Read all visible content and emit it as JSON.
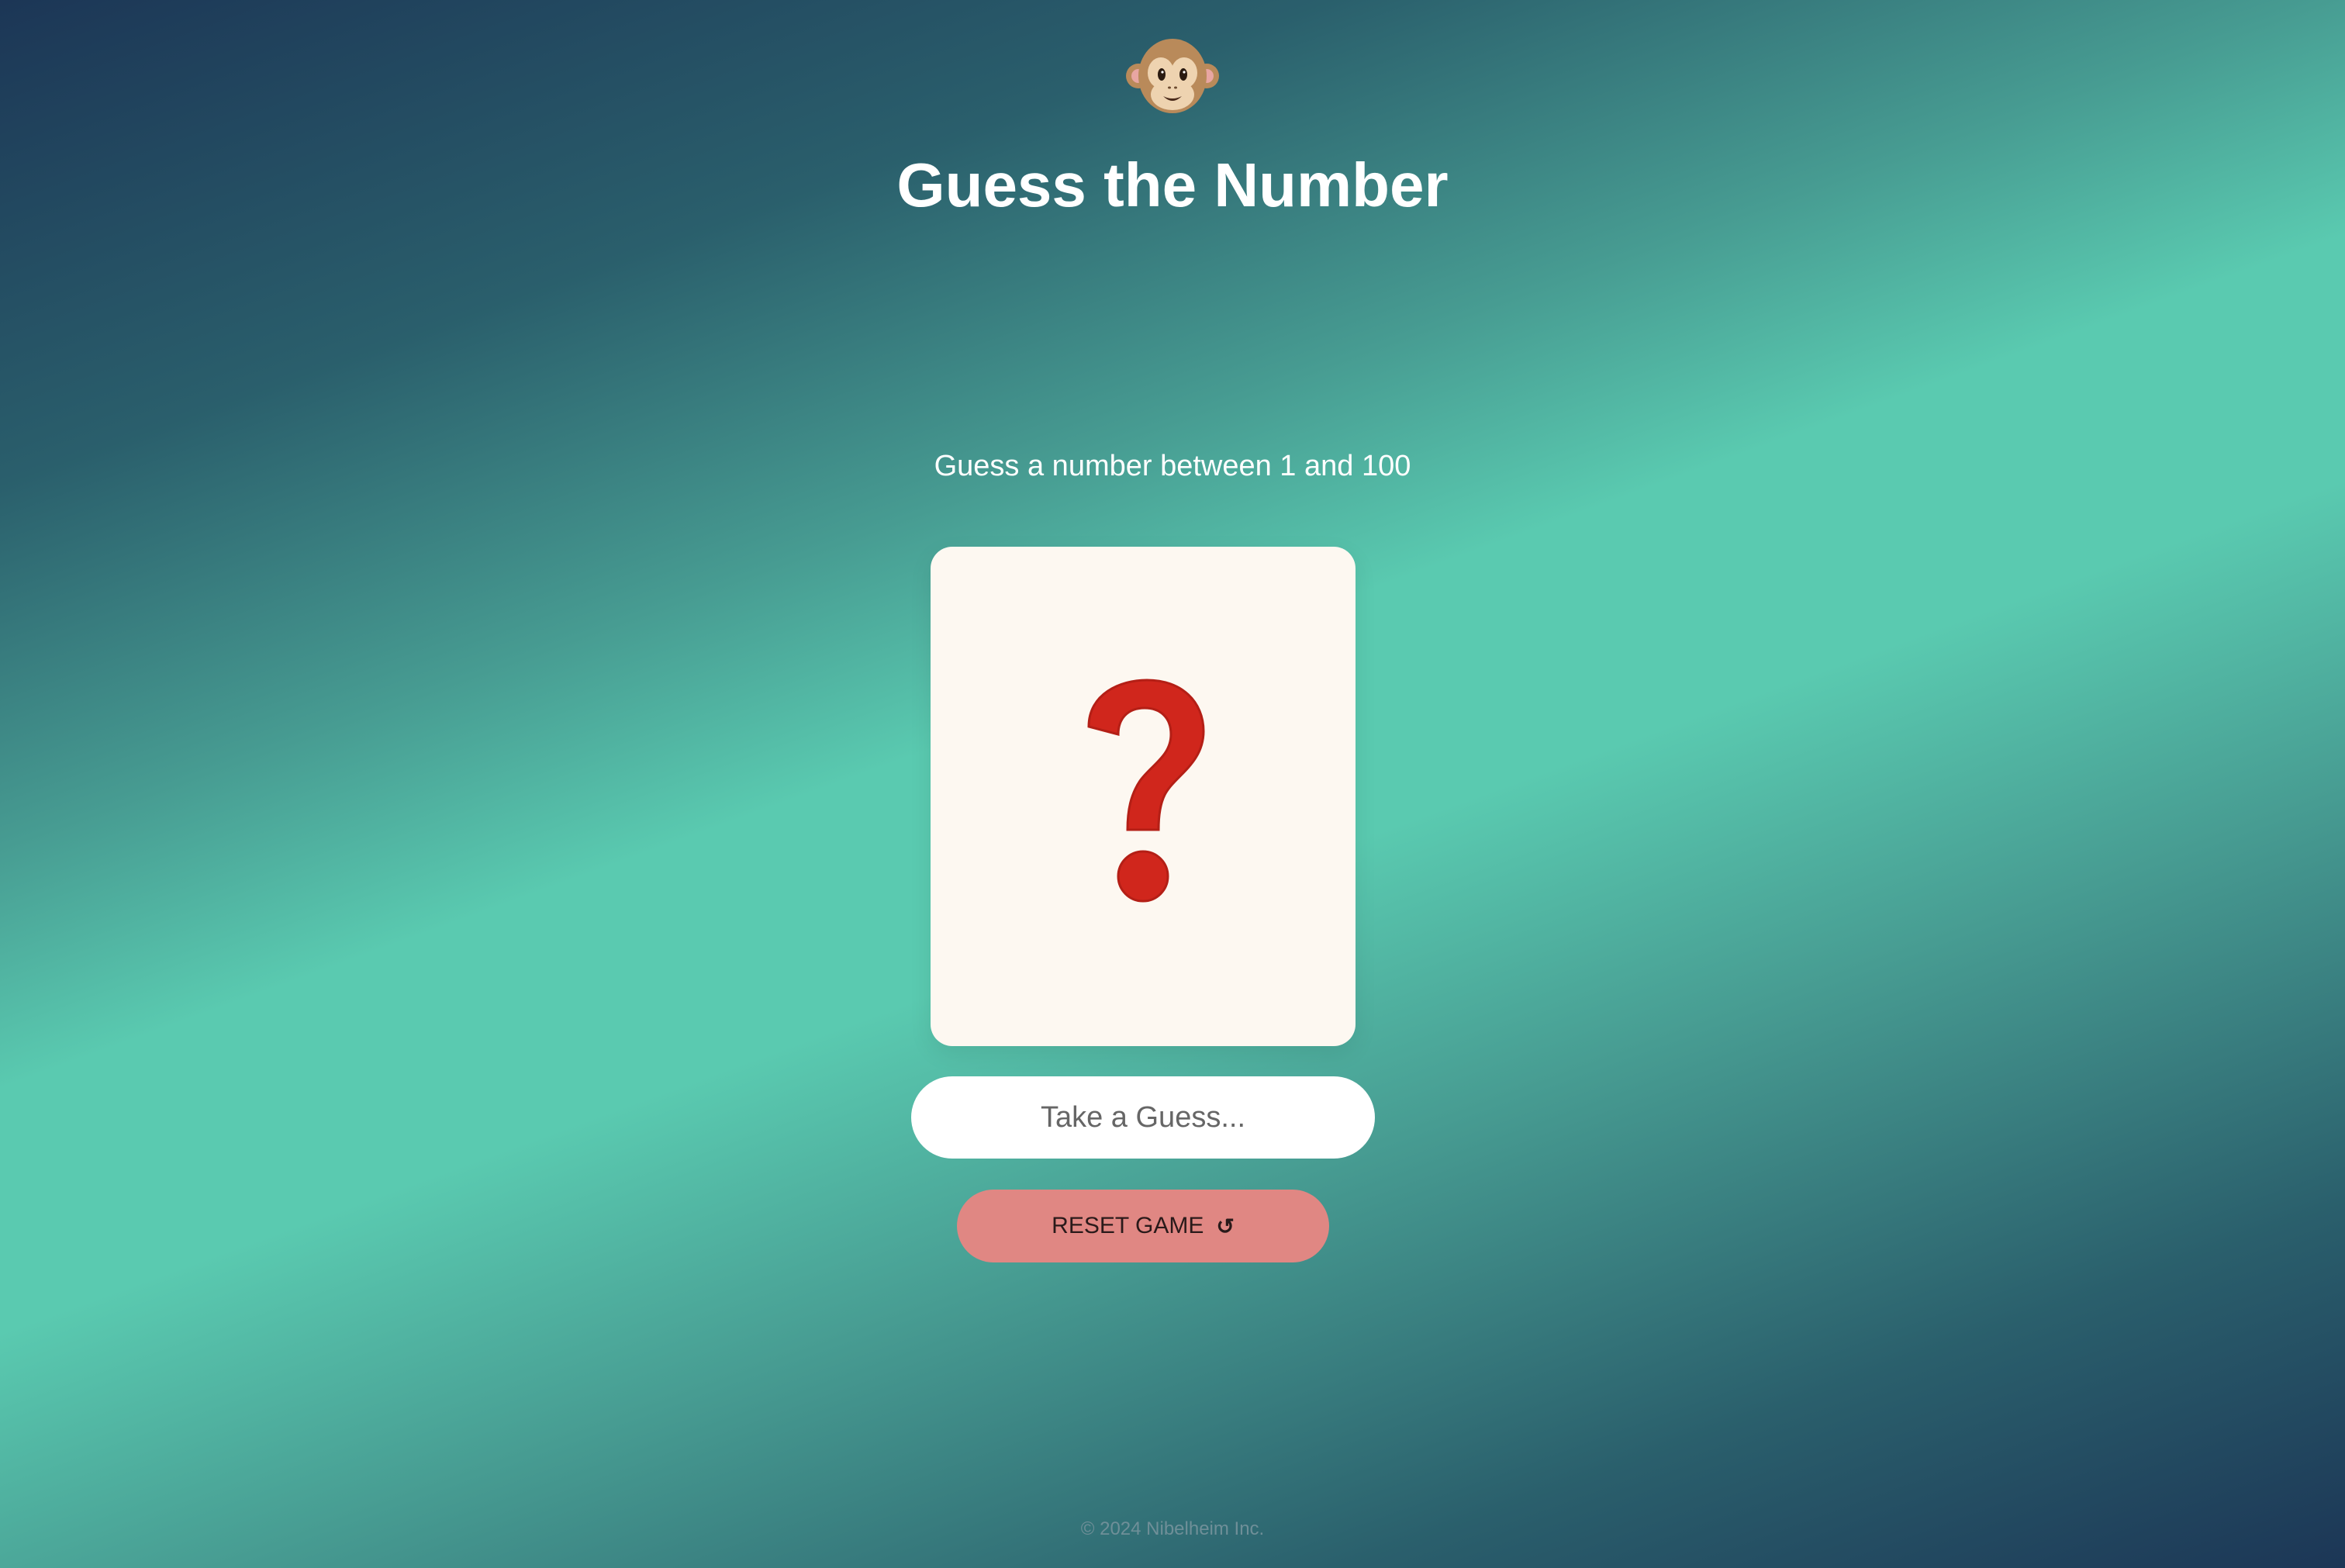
{
  "header": {
    "icon": "monkey-face-icon",
    "title": "Guess the Number"
  },
  "game": {
    "prompt": "Guess a number between 1 and 100",
    "card_icon": "question-mark-icon",
    "input_placeholder": "Take a Guess...",
    "input_value": "",
    "reset_label": "RESET GAME",
    "reset_icon": "↺"
  },
  "footer": {
    "copyright": "© 2024 Nibelheim Inc."
  },
  "colors": {
    "card_background": "#fdf8f1",
    "question_mark": "#d0261c",
    "reset_button": "#e08783",
    "gradient_mid": "#5acab0",
    "gradient_edge": "#1c3656"
  }
}
